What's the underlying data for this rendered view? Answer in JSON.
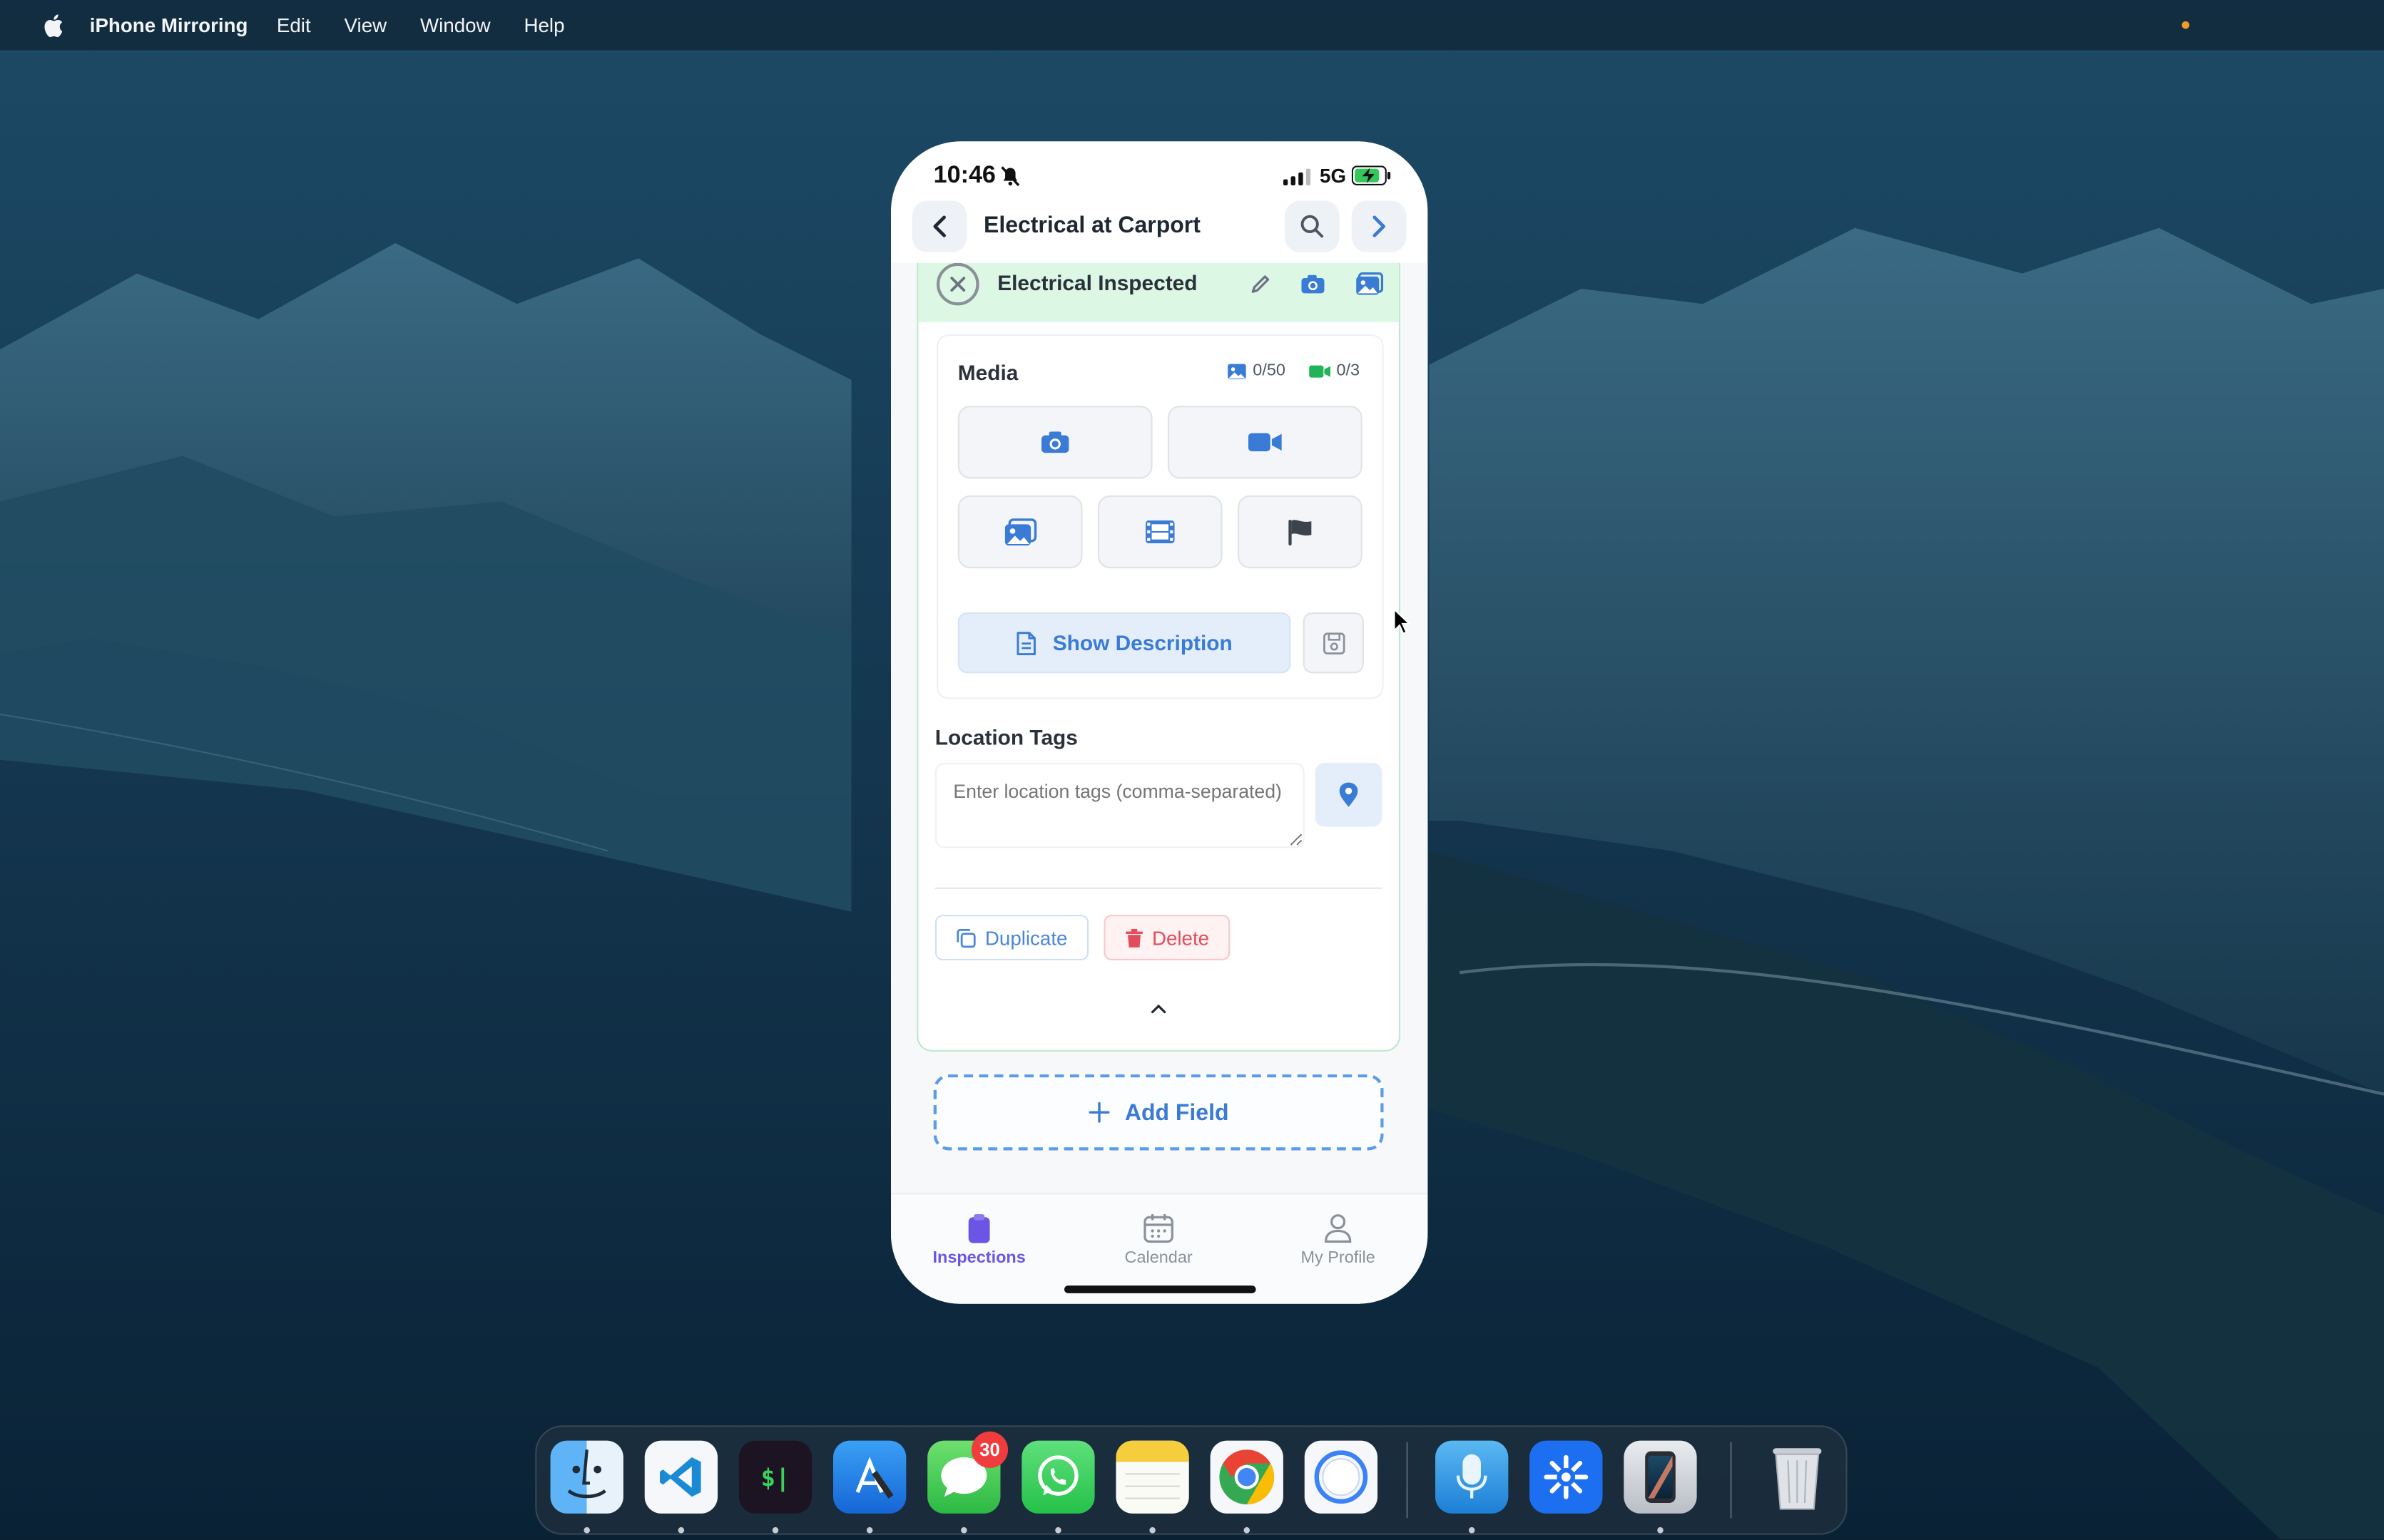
{
  "menubar": {
    "app_name": "iPhone Mirroring",
    "items": [
      "Edit",
      "View",
      "Window",
      "Help"
    ]
  },
  "phone": {
    "status": {
      "time": "10:46",
      "network": "5G"
    },
    "nav": {
      "title": "Electrical at Carport"
    },
    "field": {
      "title": "Electrical Inspected",
      "media": {
        "label": "Media",
        "photo_count": "0/50",
        "video_count": "0/3",
        "show_description_label": "Show Description"
      },
      "location": {
        "label": "Location Tags",
        "placeholder": "Enter location tags (comma-separated)"
      },
      "duplicate_label": "Duplicate",
      "delete_label": "Delete"
    },
    "add_field_label": "Add Field",
    "tabs": [
      {
        "label": "Inspections",
        "icon": "clipboard-icon",
        "active": true
      },
      {
        "label": "Calendar",
        "icon": "calendar-icon",
        "active": false
      },
      {
        "label": "My Profile",
        "icon": "person-icon",
        "active": false
      }
    ]
  },
  "dock": {
    "apps": [
      "Finder",
      "Visual Studio Code",
      "Terminal",
      "Xcode",
      "Messages",
      "WhatsApp",
      "Notes",
      "Google Chrome",
      "Screen Recorder",
      "Voice Memos",
      "Settings",
      "iPhone Mirroring",
      "Trash"
    ],
    "messages_badge": "30"
  },
  "colors": {
    "accent": "#3a7bd5",
    "tab_active": "#6c55e4",
    "field_header": "#dcf7e4",
    "delete": "#e14d5a"
  }
}
